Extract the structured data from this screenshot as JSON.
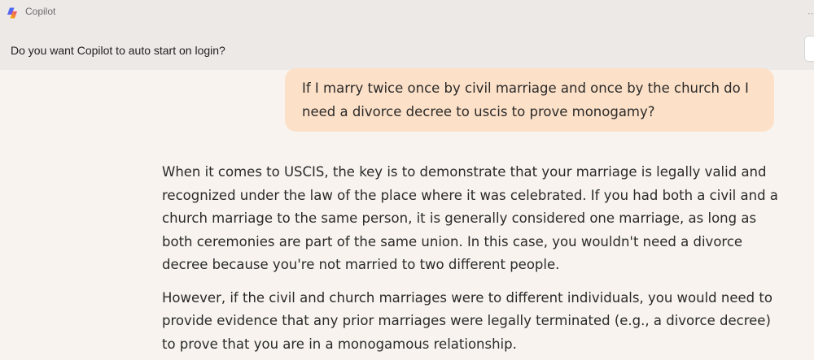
{
  "window": {
    "title": "Copilot"
  },
  "notification": {
    "text": "Do you want Copilot to auto start on login?"
  },
  "conversation": {
    "user_message": "If I marry twice once by civil marriage and once by the church do I need a divorce decree to uscis to prove monogamy?",
    "assistant_paragraphs": [
      "When it comes to USCIS, the key is to demonstrate that your marriage is legally valid and recognized under the law of the place where it was celebrated. If you had both a civil and a church marriage to the same person, it is generally considered one marriage, as long as both ceremonies are part of the same union. In this case, you wouldn't need a divorce decree because you're not married to two different people.",
      "However, if the civil and church marriages were to different individuals, you would need to provide evidence that any prior marriages were legally terminated (e.g., a divorce decree) to prove that you are in a monogamous relationship."
    ]
  },
  "colors": {
    "user_bubble": "#fce0c7",
    "chat_background": "#f8f3ee",
    "titlebar": "#ece9e6"
  }
}
